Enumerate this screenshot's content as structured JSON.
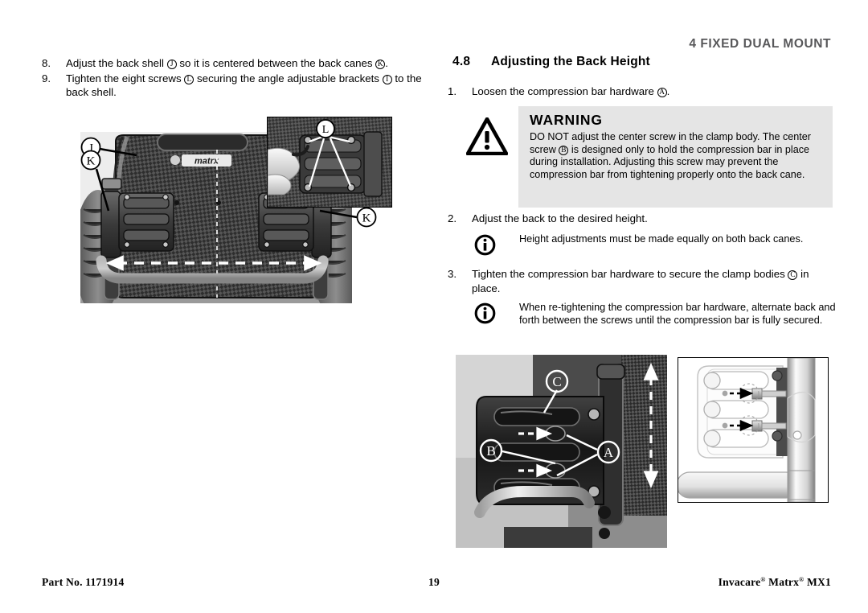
{
  "header": {
    "running_title": "4 FIXED DUAL MOUNT"
  },
  "left_column": {
    "steps": [
      {
        "num": "8.",
        "text_a": "Adjust the back shell ",
        "ref_a": "J",
        "text_b": " so it is centered between the back canes ",
        "ref_b": "K",
        "text_c": "."
      },
      {
        "num": "9.",
        "text_a": "Tighten the eight screws ",
        "ref_a": "L",
        "text_b": " securing the angle adjustable brackets ",
        "ref_b": "I",
        "text_c": " to the back shell."
      }
    ]
  },
  "section": {
    "number": "4.8",
    "title": "Adjusting the Back Height",
    "step1": {
      "num": "1.",
      "text_a": "Loosen the compression bar hardware ",
      "ref_a": "A",
      "text_b": "."
    },
    "step2": {
      "num": "2.",
      "text_a": "Adjust the back to the desired height."
    },
    "step3": {
      "num": "3.",
      "text_a": "Tighten the compression bar hardware to secure the clamp bodies ",
      "ref_a": "C",
      "text_b": " in place."
    }
  },
  "warning": {
    "icon": "warning-triangle-icon",
    "title": "WARNING",
    "body_a": "DO NOT adjust the center screw in the clamp body. The center screw ",
    "ref": "B",
    "body_b": " is designed only to hold the compression bar in place during installation. Adjusting this screw may prevent the compression bar from tightening properly onto the back cane.",
    "bg_color": "#e5e5e5"
  },
  "notes": [
    {
      "icon": "info-icon",
      "text": "Height adjustments must be made equally on both back canes."
    },
    {
      "icon": "info-icon",
      "text": "When re-tightening the compression bar hardware, alternate back and forth between the screws until the compression bar is fully secured."
    }
  ],
  "figures": {
    "main_photo": {
      "name": "back-shell-centering-photo",
      "callouts": [
        "J",
        "K",
        "K"
      ]
    },
    "inset_photo": {
      "name": "bracket-screws-inset-photo",
      "callouts": [
        "L"
      ]
    },
    "clamp_photo": {
      "name": "clamp-body-photo",
      "callouts": [
        "C",
        "B",
        "A"
      ]
    },
    "cad_drawing": {
      "name": "clamp-hardware-line-drawing",
      "callouts": []
    }
  },
  "footer": {
    "part_label": "Part No. 1171914",
    "page_number": "19",
    "brand_a": "Invacare",
    "brand_b": " Matrx",
    "brand_c": " MX1",
    "reg_mark": "®"
  }
}
